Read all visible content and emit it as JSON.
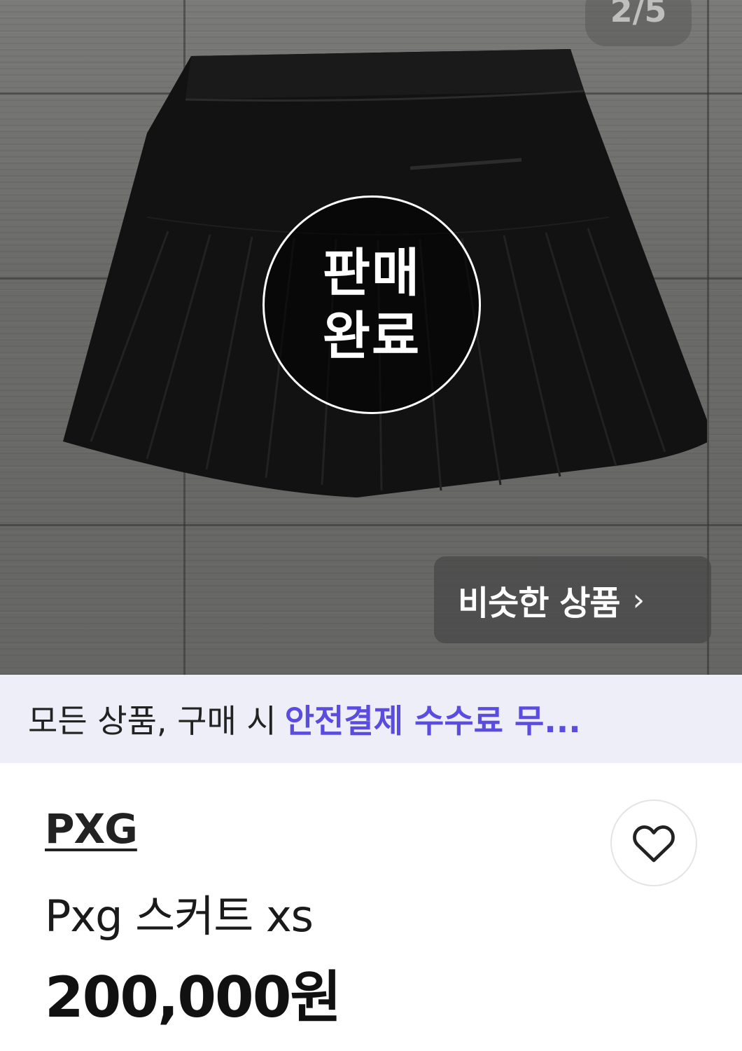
{
  "gallery": {
    "counter": "2/5",
    "sold_badge": {
      "line1": "판매",
      "line2": "완료"
    },
    "similar_button": {
      "label": "비슷한 상품",
      "chevron": "›"
    }
  },
  "promo": {
    "plain_text": "모든 상품, 구매 시",
    "accent_text": "안전결제 수수료 무...",
    "accent_color": "#5b4ce0"
  },
  "product": {
    "brand": "PXG",
    "title": "Pxg 스커트 xs",
    "price": "200,000원",
    "like_icon": "heart-icon"
  }
}
